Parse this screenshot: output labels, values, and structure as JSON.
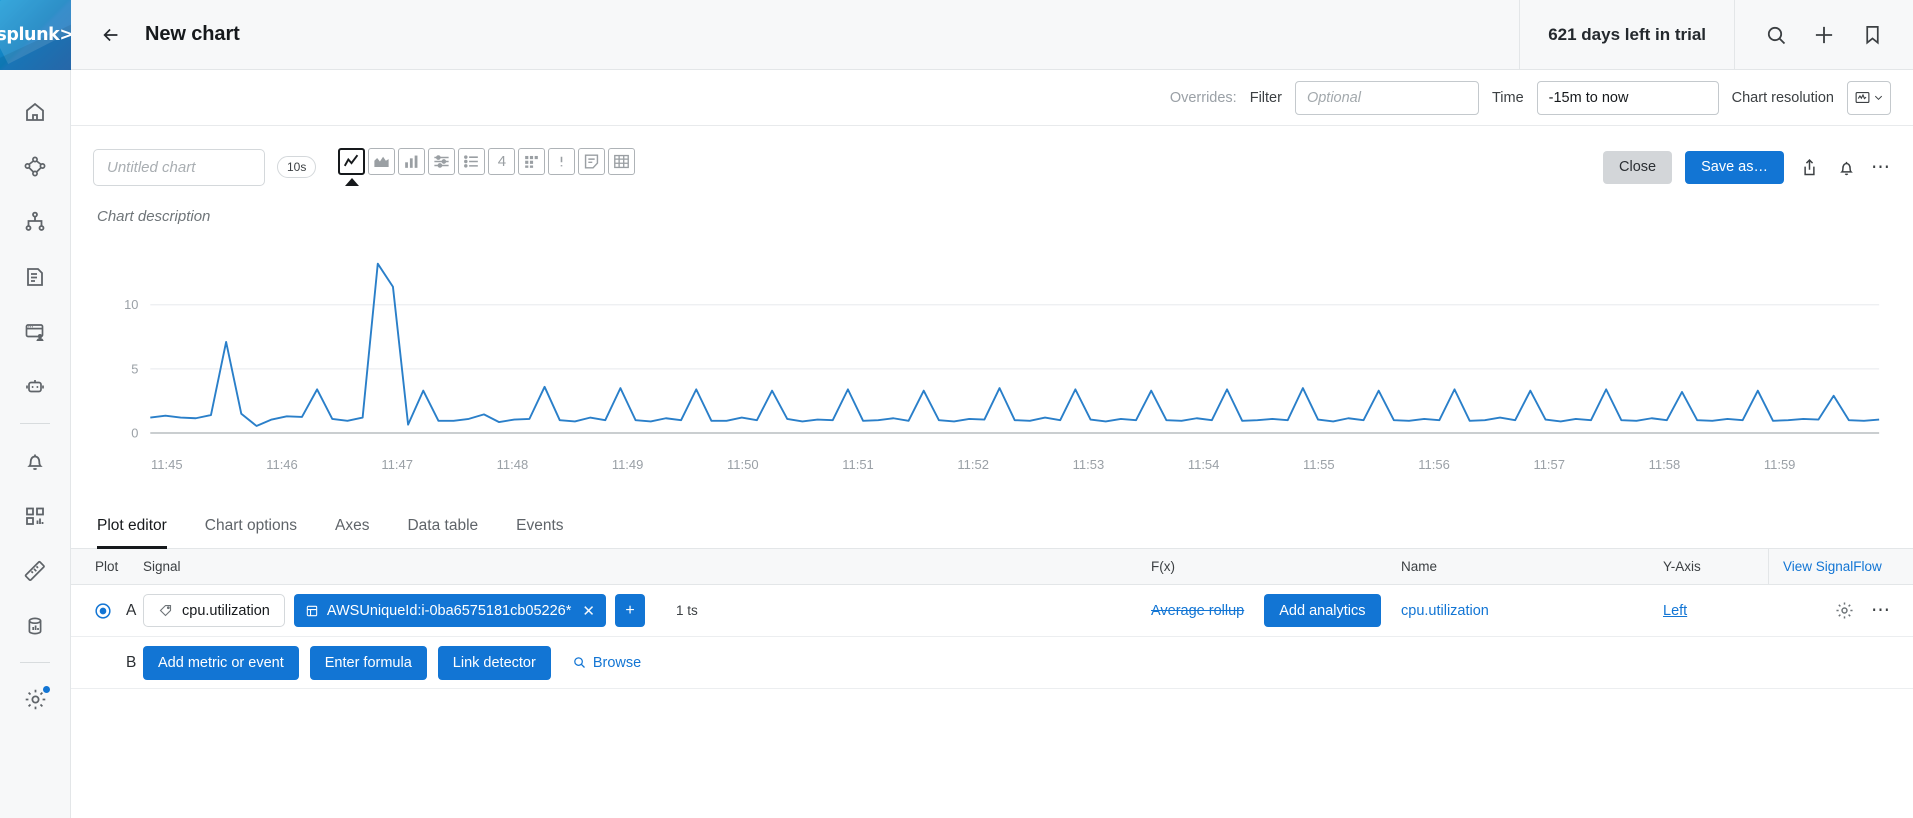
{
  "brand": {
    "logo_text": "splunk>",
    "accent": "#1275d4"
  },
  "sidebar": {
    "items": [
      {
        "name": "home",
        "label": "Home"
      },
      {
        "name": "apm",
        "label": "APM"
      },
      {
        "name": "infrastructure",
        "label": "Infrastructure"
      },
      {
        "name": "log-observer",
        "label": "Log Observer"
      },
      {
        "name": "rum",
        "label": "RUM"
      },
      {
        "name": "synthetics",
        "label": "Synthetics"
      },
      {
        "name": "alerts",
        "label": "Alerts"
      },
      {
        "name": "dashboards",
        "label": "Dashboards"
      },
      {
        "name": "metrics",
        "label": "Metrics"
      },
      {
        "name": "data-management",
        "label": "Data Management"
      },
      {
        "name": "settings",
        "label": "Settings"
      }
    ]
  },
  "header": {
    "back_label": "Back",
    "title": "New chart",
    "trial_text": "621 days left in trial",
    "icons": [
      "search-icon",
      "plus-icon",
      "bookmark-icon"
    ]
  },
  "overrides": {
    "label": "Overrides:",
    "filter_label": "Filter",
    "filter_value": "",
    "filter_placeholder": "Optional",
    "time_label": "Time",
    "time_value": "-15m to now",
    "resolution_label": "Chart resolution"
  },
  "toolbar": {
    "chart_title_value": "",
    "chart_title_placeholder": "Untitled chart",
    "resolution_badge": "10s",
    "chart_types": [
      {
        "name": "line-chart",
        "label": "Line chart",
        "active": true
      },
      {
        "name": "area-chart",
        "label": "Area chart",
        "active": false
      },
      {
        "name": "column-chart",
        "label": "Column chart",
        "active": false
      },
      {
        "name": "histogram-chart",
        "label": "Histogram",
        "active": false
      },
      {
        "name": "list-chart",
        "label": "List",
        "active": false
      },
      {
        "name": "single-value-chart",
        "label": "4",
        "active": false
      },
      {
        "name": "heatmap-chart",
        "label": "Heatmap",
        "active": false
      },
      {
        "name": "event-feed",
        "label": "Event feed",
        "active": false
      },
      {
        "name": "text-note",
        "label": "Text note",
        "active": false
      },
      {
        "name": "table-chart",
        "label": "Table",
        "active": false
      }
    ],
    "close_label": "Close",
    "save_label": "Save as…",
    "action_icons": [
      "share-icon",
      "bell-icon",
      "overflow-icon"
    ]
  },
  "chart_description": "Chart description",
  "chart_data": {
    "type": "line",
    "title": "",
    "xlabel": "",
    "ylabel": "",
    "ylim": [
      0,
      14.5
    ],
    "yticks": [
      0,
      5,
      10
    ],
    "grid": true,
    "legend": false,
    "line_color": "#2a7fc9",
    "x_tick_labels": [
      "11:45",
      "11:46",
      "11:47",
      "11:48",
      "11:49",
      "11:50",
      "11:51",
      "11:52",
      "11:53",
      "11:54",
      "11:55",
      "11:56",
      "11:57",
      "11:58",
      "11:59"
    ],
    "series": [
      {
        "name": "cpu.utilization",
        "values": [
          1.2,
          1.35,
          1.2,
          1.15,
          1.4,
          7.1,
          1.5,
          0.55,
          1.05,
          1.3,
          1.25,
          3.4,
          1.1,
          0.95,
          1.2,
          13.2,
          11.4,
          0.65,
          3.3,
          0.95,
          0.95,
          1.1,
          1.45,
          0.85,
          1.05,
          1.1,
          3.6,
          1.0,
          0.9,
          1.2,
          1.0,
          3.5,
          1.0,
          0.9,
          1.15,
          1.0,
          3.4,
          0.95,
          0.95,
          1.2,
          1.0,
          3.3,
          1.1,
          0.9,
          1.05,
          1.0,
          3.4,
          0.95,
          1.0,
          1.15,
          0.95,
          3.3,
          1.0,
          0.9,
          1.1,
          1.05,
          3.5,
          1.0,
          0.95,
          1.2,
          1.0,
          3.4,
          1.05,
          0.9,
          1.1,
          1.0,
          3.3,
          1.0,
          0.95,
          1.15,
          1.0,
          3.4,
          0.95,
          1.0,
          1.1,
          1.0,
          3.5,
          1.05,
          0.9,
          1.15,
          1.0,
          3.3,
          1.0,
          0.95,
          1.1,
          1.0,
          3.4,
          0.95,
          1.0,
          1.2,
          1.0,
          3.3,
          1.05,
          0.9,
          1.1,
          1.0,
          3.4,
          1.0,
          0.95,
          1.15,
          1.0,
          3.2,
          1.0,
          0.95,
          1.1,
          1.0,
          3.3,
          0.95,
          1.0,
          1.1,
          1.05,
          2.9,
          1.0,
          0.95,
          1.05
        ]
      }
    ]
  },
  "tabs": [
    {
      "label": "Plot editor",
      "active": true
    },
    {
      "label": "Chart options",
      "active": false
    },
    {
      "label": "Axes",
      "active": false
    },
    {
      "label": "Data table",
      "active": false
    },
    {
      "label": "Events",
      "active": false
    }
  ],
  "plot_table": {
    "headers": {
      "plot": "Plot",
      "signal": "Signal",
      "fx": "F(x)",
      "name": "Name",
      "yaxis": "Y-Axis",
      "signalflow": "View SignalFlow"
    },
    "rows": [
      {
        "letter": "A",
        "metric": "cpu.utilization",
        "filter_chip": "AWSUniqueId:i-0ba6575181cb05226*",
        "add_filter_label": "+",
        "ts_count": "1 ts",
        "rollup": "Average rollup",
        "analytics_label": "Add analytics",
        "name": "cpu.utilization",
        "yaxis": "Left"
      },
      {
        "letter": "B",
        "add_metric_label": "Add metric or event",
        "formula_label": "Enter formula",
        "detector_label": "Link detector",
        "browse_label": "Browse"
      }
    ]
  }
}
